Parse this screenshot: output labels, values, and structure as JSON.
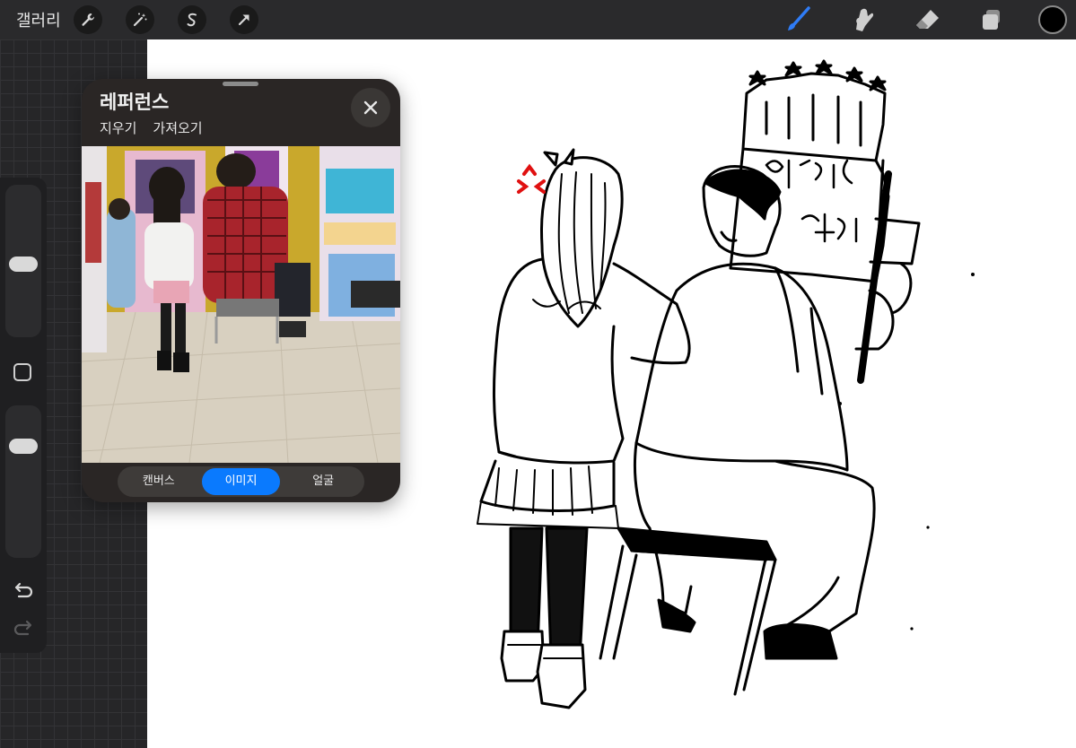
{
  "toolbar": {
    "gallery_label": "갤러리",
    "left_tools": [
      "wrench-icon",
      "magic-wand-icon",
      "selection-icon",
      "transform-arrow-icon"
    ],
    "right_tools": [
      "brush-icon",
      "smudge-icon",
      "eraser-icon",
      "layers-icon"
    ],
    "active_tool": "brush-icon",
    "accent": "#2f7cf6",
    "current_color": "#000000"
  },
  "sidebar": {
    "size_slider_value": 0.45,
    "opacity_slider_value": 0.25,
    "items": [
      "size-slider",
      "modify-button",
      "opacity-slider",
      "undo-icon",
      "redo-icon"
    ]
  },
  "reference": {
    "title": "레퍼런스",
    "actions": [
      "지우기",
      "가져오기"
    ],
    "tabs": [
      "캔버스",
      "이미지",
      "얼굴"
    ],
    "active_tab": "이미지",
    "accent": "#0a7afe"
  }
}
